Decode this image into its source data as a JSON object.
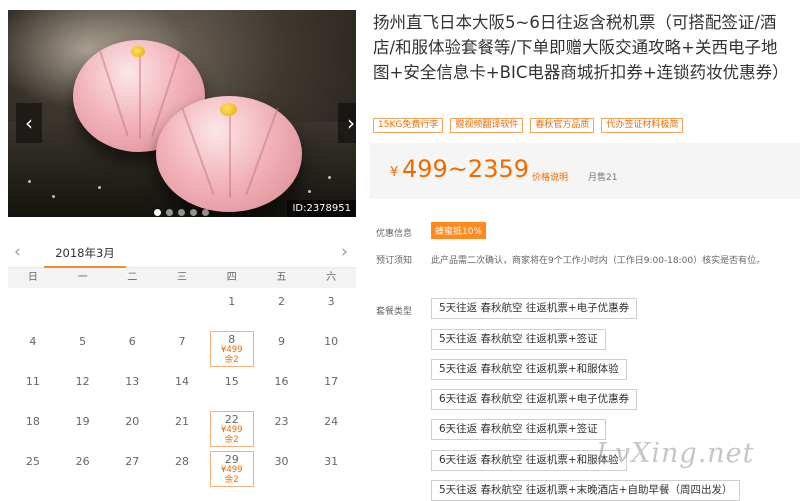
{
  "gallery": {
    "image_id": "ID:2378951",
    "prev_icon": "‹",
    "next_icon": "›"
  },
  "calendar": {
    "month": "2018年3月",
    "prev_icon": "‹",
    "next_icon": "›",
    "weekdays": [
      "日",
      "一",
      "二",
      "三",
      "四",
      "五",
      "六"
    ],
    "weeks": [
      [
        {
          "d": ""
        },
        {
          "d": ""
        },
        {
          "d": ""
        },
        {
          "d": ""
        },
        {
          "d": "1"
        },
        {
          "d": "2"
        },
        {
          "d": "3"
        }
      ],
      [
        {
          "d": "4"
        },
        {
          "d": "5"
        },
        {
          "d": "6"
        },
        {
          "d": "7"
        },
        {
          "d": "8",
          "price": "¥499",
          "stock": "余2"
        },
        {
          "d": "9"
        },
        {
          "d": "10"
        }
      ],
      [
        {
          "d": "11"
        },
        {
          "d": "12"
        },
        {
          "d": "13"
        },
        {
          "d": "14"
        },
        {
          "d": "15"
        },
        {
          "d": "16"
        },
        {
          "d": "17"
        }
      ],
      [
        {
          "d": "18"
        },
        {
          "d": "19"
        },
        {
          "d": "20"
        },
        {
          "d": "21"
        },
        {
          "d": "22",
          "price": "¥499",
          "stock": "余2"
        },
        {
          "d": "23"
        },
        {
          "d": "24"
        }
      ],
      [
        {
          "d": "25"
        },
        {
          "d": "26"
        },
        {
          "d": "27"
        },
        {
          "d": "28"
        },
        {
          "d": "29",
          "price": "¥499",
          "stock": "余2"
        },
        {
          "d": "30"
        },
        {
          "d": "31"
        }
      ]
    ]
  },
  "product": {
    "title": "扬州直飞日本大阪5~6日往返含税机票（可搭配签证/酒店/和服体验套餐等/下单即赠大阪交通攻略+关西电子地图+安全信息卡+BIC电器商城折扣券+连锁药妆优惠券）",
    "tags": [
      "15KG免费行李",
      "赠视频翻译软件",
      "春秋官方品质",
      "代办签证材料极简"
    ],
    "price": {
      "currency": "¥",
      "range": "499~2359",
      "note": "价格说明",
      "sold": "月售21"
    },
    "promo_label": "优惠信息",
    "promo": "蜂蜜抵10%",
    "notice_label": "预订须知",
    "notice": "此产品需二次确认，商家将在9个工作小时内（工作日9:00-18:00）核实是否有位。",
    "package_label": "套餐类型",
    "packages": [
      "5天往返 春秋航空 往返机票+电子优惠券",
      "5天往返 春秋航空 往返机票+签证",
      "5天往返 春秋航空 往返机票+和服体验",
      "6天往返 春秋航空 往返机票+电子优惠券",
      "6天往返 春秋航空 往返机票+签证",
      "6天往返 春秋航空 往返机票+和服体验",
      "5天往返 春秋航空 往返机票+末晚酒店+自助早餐（周四出发）"
    ]
  },
  "watermark": "LvXing.net"
}
